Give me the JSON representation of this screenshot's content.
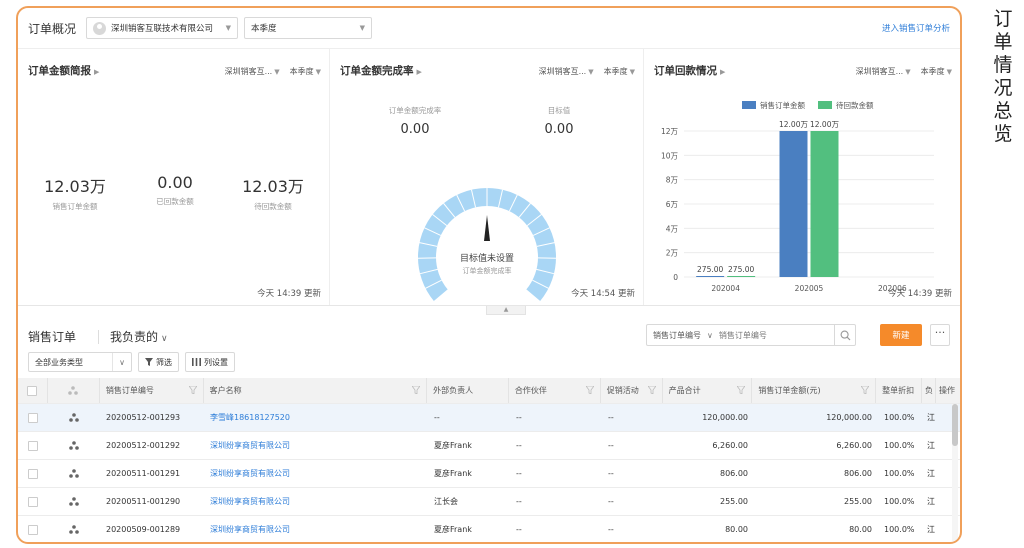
{
  "side_caption": [
    "订",
    "单",
    "情",
    "况",
    "总",
    "览"
  ],
  "topbar": {
    "title": "订单概况",
    "company": "深圳销客互联技术有限公司",
    "period": "本季度",
    "link": "进入销售订单分析"
  },
  "panel_summary": {
    "title": "订单金额简报",
    "filter_company": "深圳销客互...",
    "filter_period": "本季度",
    "kpis": [
      {
        "value": "12.03万",
        "label": "销售订单金额"
      },
      {
        "value": "0.00",
        "label": "已回款金额"
      },
      {
        "value": "12.03万",
        "label": "待回款金额"
      }
    ],
    "updated": "今天 14:39 更新"
  },
  "panel_completion": {
    "title": "订单金额完成率",
    "filter_company": "深圳销客互...",
    "filter_period": "本季度",
    "rate_label": "订单金额完成率",
    "rate_value": "0.00",
    "target_label": "目标值",
    "target_value": "0.00",
    "gauge_center": "目标值未设置",
    "gauge_sub": "订单金额完成率",
    "gauge_level": 0,
    "updated": "今天 14:54 更新"
  },
  "panel_payback": {
    "title": "订单回款情况",
    "filter_company": "深圳销客互...",
    "filter_period": "本季度",
    "updated": "今天 14:39 更新"
  },
  "chart_data": {
    "type": "bar",
    "categories": [
      "202004",
      "202005",
      "202006"
    ],
    "series": [
      {
        "name": "销售订单金额",
        "values": [
          275,
          120000,
          0
        ],
        "labels": [
          "275.00",
          "12.00万",
          ""
        ],
        "color": "#4a7fc1"
      },
      {
        "name": "待回款金额",
        "values": [
          275,
          120000,
          0
        ],
        "labels": [
          "275.00",
          "12.00万",
          ""
        ],
        "color": "#52bf7f"
      }
    ],
    "yticks": [
      "0",
      "2万",
      "4万",
      "6万",
      "8万",
      "10万",
      "12万"
    ],
    "ylim": [
      0,
      120000
    ],
    "grid": true,
    "legend": "top"
  },
  "list": {
    "title": "销售订单",
    "scope": "我负责的",
    "search_field": "销售订单编号",
    "search_placeholder": "销售订单编号",
    "new_label": "新建",
    "more_label": "···",
    "type_filter": "全部业务类型",
    "filter_label": "筛选",
    "columns_label": "列设置"
  },
  "table": {
    "columns": [
      "销售订单编号",
      "客户名称",
      "外部负责人",
      "合作伙伴",
      "促销活动",
      "产品合计",
      "销售订单金额(元)",
      "整单折扣",
      "负",
      "操作"
    ],
    "rows": [
      {
        "id": "20200512-001293",
        "customer": "李雪峰18618127520",
        "owner": "--",
        "partner": "--",
        "promo": "--",
        "subtotal": "120,000.00",
        "amount": "120,000.00",
        "discount": "100.0%",
        "extra": "江"
      },
      {
        "id": "20200512-001292",
        "customer": "深圳纷享商贸有限公司",
        "owner": "夏彦Frank",
        "partner": "--",
        "promo": "--",
        "subtotal": "6,260.00",
        "amount": "6,260.00",
        "discount": "100.0%",
        "extra": "江"
      },
      {
        "id": "20200511-001291",
        "customer": "深圳纷享商贸有限公司",
        "owner": "夏彦Frank",
        "partner": "--",
        "promo": "--",
        "subtotal": "806.00",
        "amount": "806.00",
        "discount": "100.0%",
        "extra": "江"
      },
      {
        "id": "20200511-001290",
        "customer": "深圳纷享商贸有限公司",
        "owner": "江长会",
        "partner": "--",
        "promo": "--",
        "subtotal": "255.00",
        "amount": "255.00",
        "discount": "100.0%",
        "extra": "江"
      },
      {
        "id": "20200509-001289",
        "customer": "深圳纷享商贸有限公司",
        "owner": "夏彦Frank",
        "partner": "--",
        "promo": "--",
        "subtotal": "80.00",
        "amount": "80.00",
        "discount": "100.0%",
        "extra": "江"
      }
    ]
  },
  "colors": {
    "accent": "#f58a2a",
    "link": "#2f7ed8",
    "frame": "#f0a05a",
    "gauge": "#a9d6f5"
  }
}
